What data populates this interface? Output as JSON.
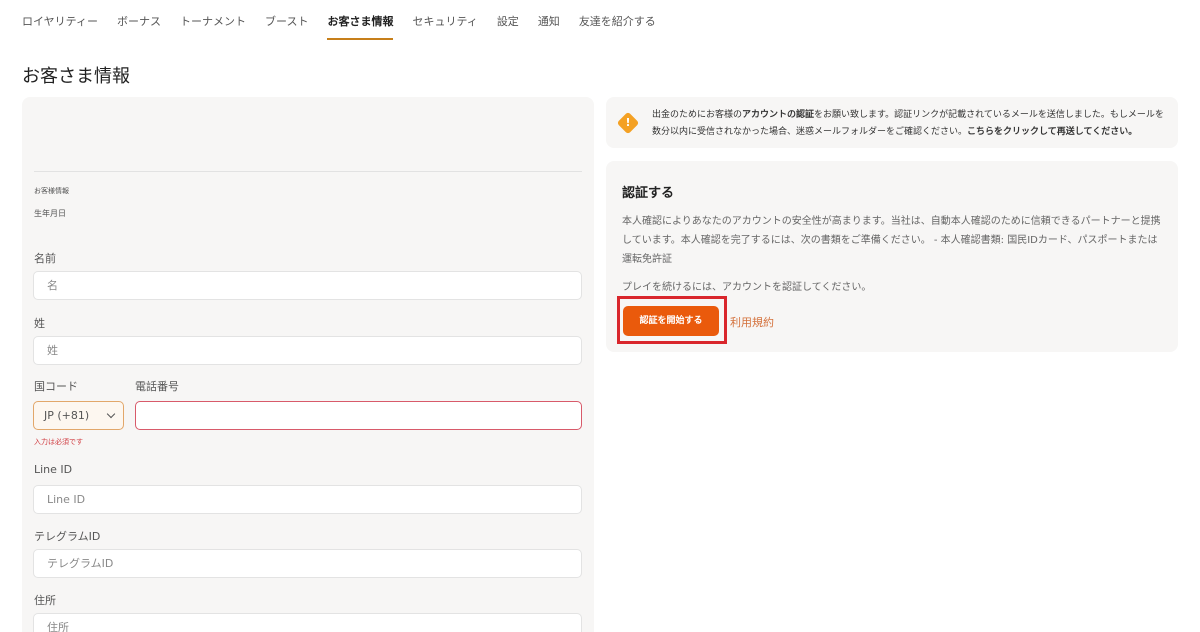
{
  "nav": {
    "items": [
      {
        "label": "ロイヤリティー"
      },
      {
        "label": "ボーナス"
      },
      {
        "label": "トーナメント"
      },
      {
        "label": "ブースト"
      },
      {
        "label": "お客さま情報"
      },
      {
        "label": "セキュリティ"
      },
      {
        "label": "設定"
      },
      {
        "label": "通知"
      },
      {
        "label": "友達を紹介する"
      }
    ],
    "active_index": 4
  },
  "page": {
    "title": "お客さま情報"
  },
  "form": {
    "section_label": "お客様情報",
    "dob_label": "生年月日",
    "first_name": {
      "label": "名前",
      "placeholder": "名"
    },
    "last_name": {
      "label": "姓",
      "placeholder": "姓"
    },
    "country_code": {
      "label": "国コード",
      "value": "JP (+81)"
    },
    "phone": {
      "label": "電話番号",
      "value": ""
    },
    "required_error": "入力は必須です",
    "line_id": {
      "label": "Line ID",
      "placeholder": "Line ID"
    },
    "telegram": {
      "label": "テレグラムID",
      "placeholder": "テレグラムID"
    },
    "address": {
      "label": "住所",
      "placeholder": "住所"
    }
  },
  "notice": {
    "part1": "出金のためにお客様の",
    "part2_bold": "アカウントの認証",
    "part3": "をお願い致します。認証リンクが記載されているメールを送信しました。もしメールを数分以内に受信されなかった場合、迷惑メールフォルダーをご確認ください。",
    "part4_bold": "こちらをクリックして再送してください。"
  },
  "verify": {
    "title": "認証する",
    "description": "本人確認によりあなたのアカウントの安全性が高まります。当社は、自動本人確認のために信頼できるパートナーと提携しています。本人確認を完了するには、次の書類をご準備ください。 - 本人確認書類: 国民IDカード、パスポートまたは運転免許証",
    "prompt": "プレイを続けるには、アカウントを認証してください。",
    "start_button": "認証を開始する",
    "terms_link": "利用規約"
  },
  "colors": {
    "accent": "#ea5a0c",
    "highlight": "#d9262c",
    "warning": "#f4a124",
    "error": "#d0393e",
    "link": "#d4713c"
  }
}
